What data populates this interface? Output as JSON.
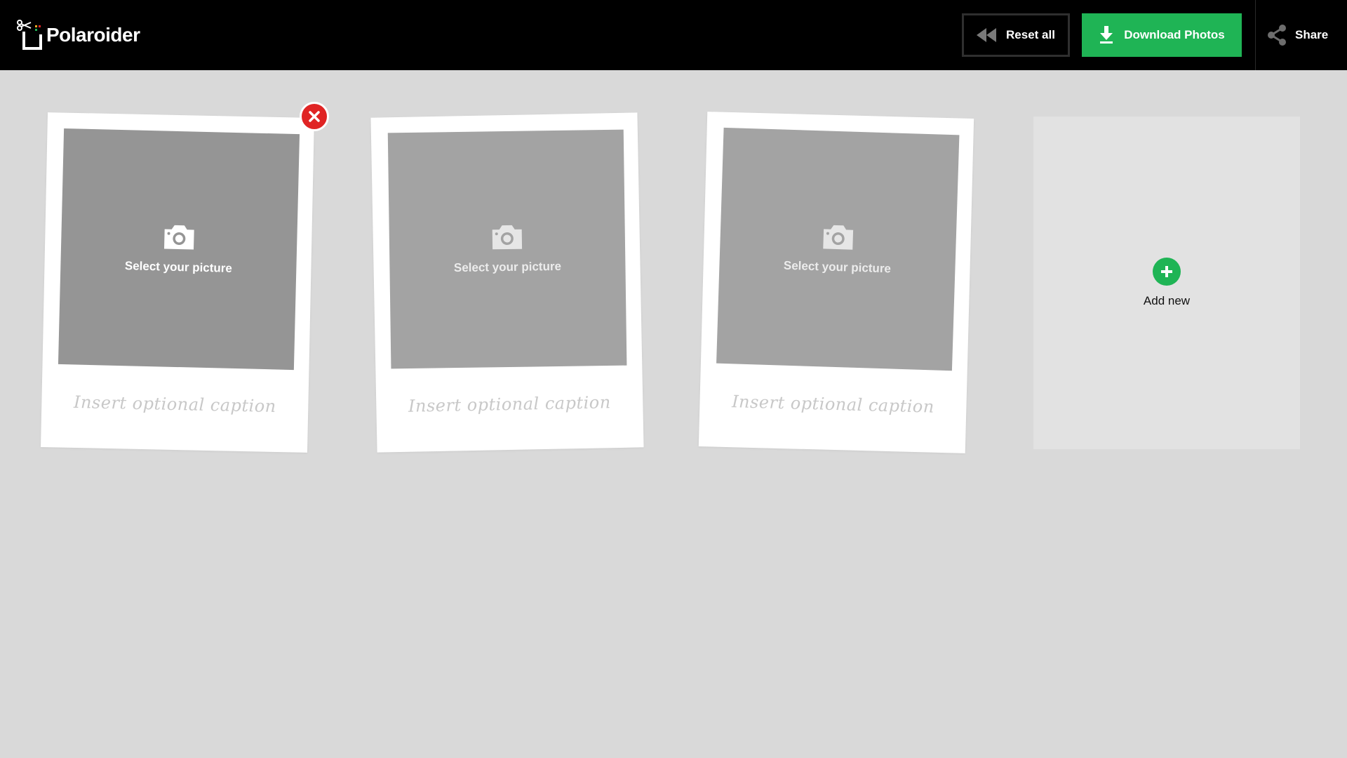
{
  "app": {
    "name": "Polaroider"
  },
  "header": {
    "reset_label": "Reset all",
    "download_label": "Download Photos",
    "share_label": "Share"
  },
  "cards": [
    {
      "select_label": "Select your picture",
      "caption_placeholder": "Insert optional caption"
    },
    {
      "select_label": "Select your picture",
      "caption_placeholder": "Insert optional caption"
    },
    {
      "select_label": "Select your picture",
      "caption_placeholder": "Insert optional caption"
    }
  ],
  "add_tile": {
    "label": "Add new"
  },
  "colors": {
    "header_bg": "#000000",
    "page_bg": "#d9d9d9",
    "accent_green": "#1fb455",
    "delete_red": "#e02424",
    "photo_placeholder": "#a3a3a3"
  },
  "icons": {
    "logo": "polaroid-scissors-logo-icon",
    "reset": "rewind-icon",
    "download": "download-arrow-icon",
    "share": "share-nodes-icon",
    "photo": "camera-icon",
    "delete": "close-icon",
    "add": "plus-icon"
  }
}
